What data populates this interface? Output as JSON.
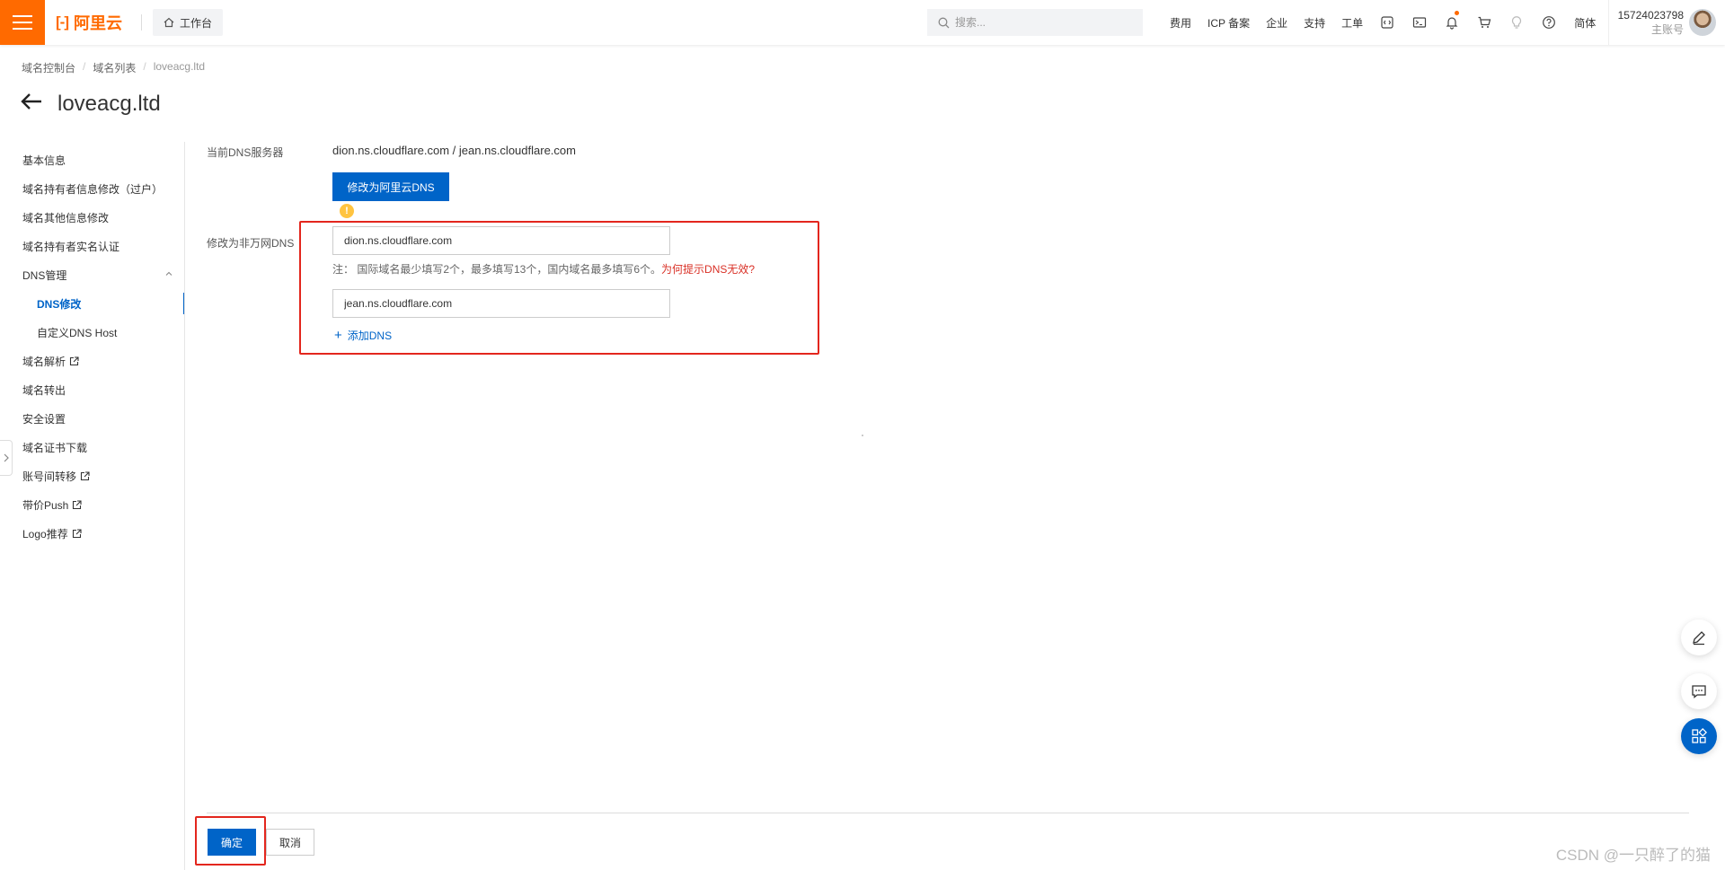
{
  "topbar": {
    "brand": "阿里云",
    "brand_mark": "[-]",
    "workbench": "工作台",
    "search_placeholder": "搜索...",
    "links": [
      "费用",
      "ICP 备案",
      "企业",
      "支持",
      "工单"
    ],
    "lang": "简体",
    "account_id": "15724023798",
    "account_role": "主账号"
  },
  "breadcrumb": {
    "items": [
      "域名控制台",
      "域名列表"
    ],
    "current": "loveacg.ltd"
  },
  "page": {
    "title": "loveacg.ltd"
  },
  "sidebar": {
    "items": [
      {
        "label": "基本信息"
      },
      {
        "label": "域名持有者信息修改（过户）"
      },
      {
        "label": "域名其他信息修改"
      },
      {
        "label": "域名持有者实名认证"
      },
      {
        "label": "DNS管理"
      },
      {
        "label": "DNS修改"
      },
      {
        "label": "自定义DNS Host"
      },
      {
        "label": "域名解析"
      },
      {
        "label": "域名转出"
      },
      {
        "label": "安全设置"
      },
      {
        "label": "域名证书下载"
      },
      {
        "label": "账号间转移"
      },
      {
        "label": "带价Push"
      },
      {
        "label": "Logo推荐"
      }
    ]
  },
  "form": {
    "current_dns_label": "当前DNS服务器",
    "current_dns_value": "dion.ns.cloudflare.com / jean.ns.cloudflare.com",
    "switch_button": "修改为阿里云DNS",
    "warn_glyph": "!",
    "custom_dns_label": "修改为非万网DNS",
    "dns1": "dion.ns.cloudflare.com",
    "dns2": "jean.ns.cloudflare.com",
    "note": "注：  国际域名最少填写2个，最多填写13个，国内域名最多填写6个。",
    "note_link": "为何提示DNS无效?",
    "add_dns": "添加DNS",
    "add_glyph": "+"
  },
  "footer": {
    "confirm": "确定",
    "cancel": "取消"
  },
  "watermark": "CSDN @一只醉了的猫",
  "colors": {
    "brand": "#ff6a00",
    "primary": "#0064c8",
    "highlight": "#e3261d",
    "warning": "#ffc440"
  }
}
